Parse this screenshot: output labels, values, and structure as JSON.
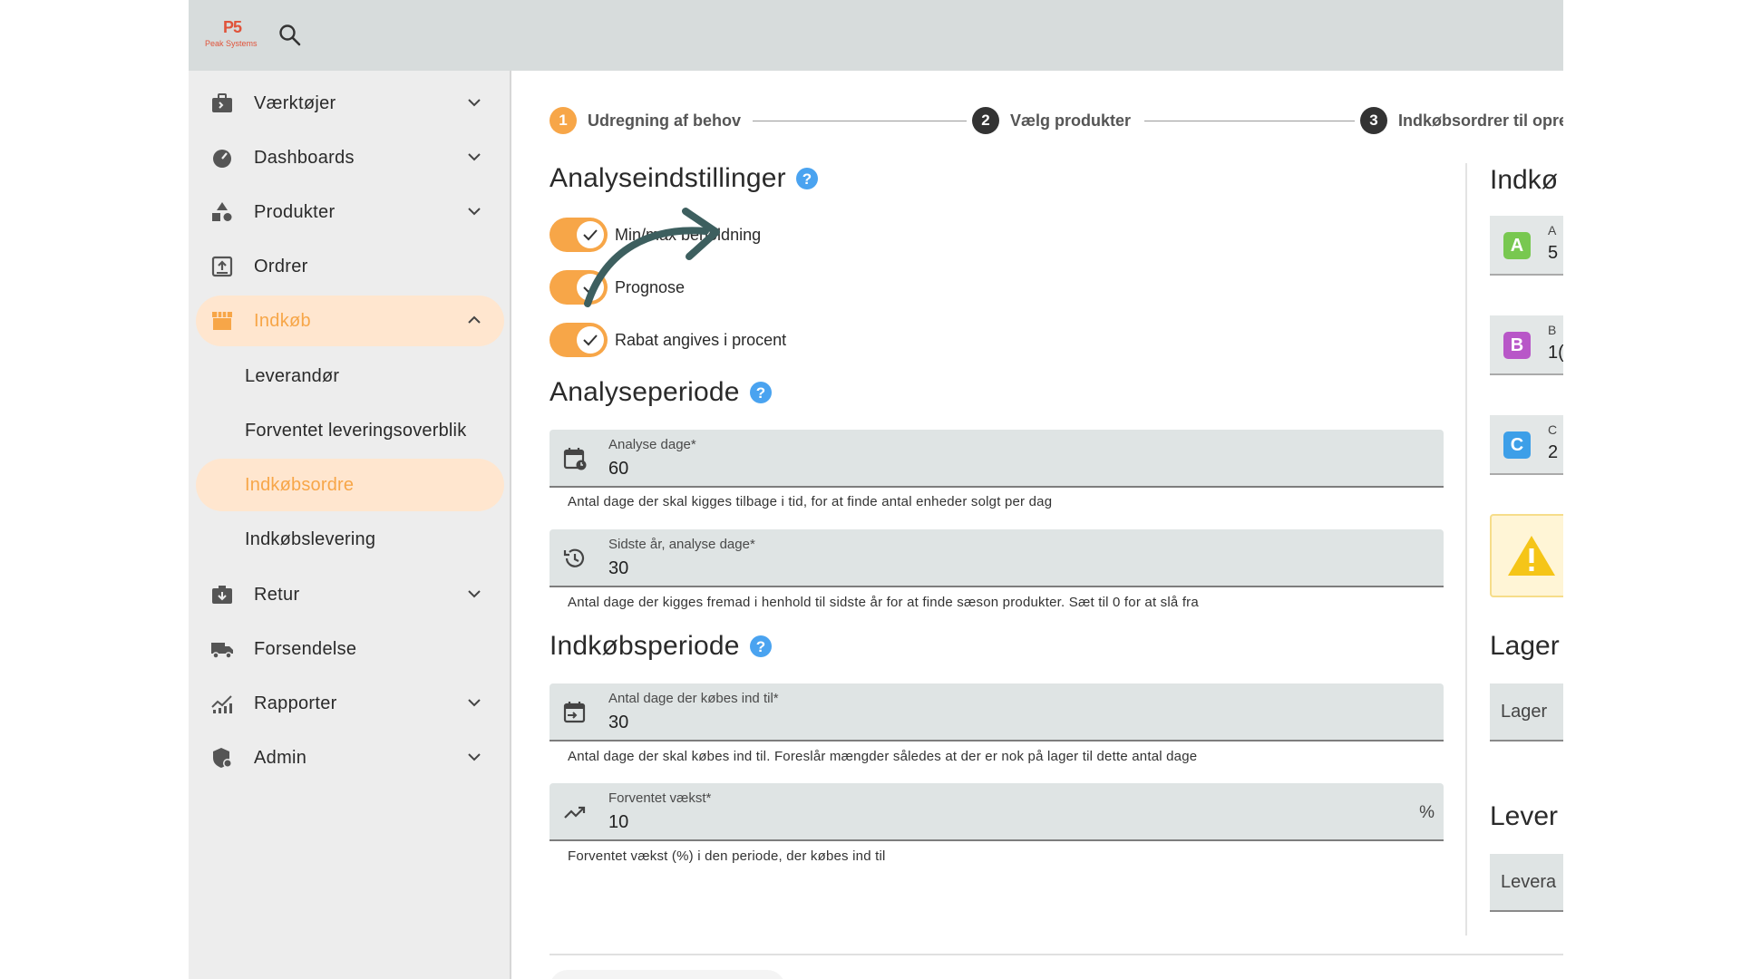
{
  "brand": {
    "mark": "P5",
    "name": "Peak Systems"
  },
  "sidebar": {
    "items": [
      {
        "label": "Værktøjer",
        "icon": "toolbox-icon",
        "expandable": true
      },
      {
        "label": "Dashboards",
        "icon": "gauge-icon",
        "expandable": true
      },
      {
        "label": "Produkter",
        "icon": "shapes-icon",
        "expandable": true
      },
      {
        "label": "Ordrer",
        "icon": "order-upload-icon",
        "expandable": false
      },
      {
        "label": "Indkøb",
        "icon": "store-icon",
        "expandable": true,
        "expanded": true,
        "active": true
      },
      {
        "label": "Retur",
        "icon": "return-box-icon",
        "expandable": true
      },
      {
        "label": "Forsendelse",
        "icon": "truck-icon",
        "expandable": false
      },
      {
        "label": "Rapporter",
        "icon": "chart-icon",
        "expandable": true
      },
      {
        "label": "Admin",
        "icon": "admin-shield-icon",
        "expandable": true
      }
    ],
    "subitems": [
      {
        "label": "Leverandør"
      },
      {
        "label": "Forventet leveringsoverblik"
      },
      {
        "label": "Indkøbsordre",
        "active": true
      },
      {
        "label": "Indkøbslevering"
      }
    ]
  },
  "stepper": [
    {
      "num": "1",
      "label": "Udregning af behov",
      "state": "active"
    },
    {
      "num": "2",
      "label": "Vælg produkter",
      "state": "pending"
    },
    {
      "num": "3",
      "label": "Indkøbsordrer til opre",
      "state": "pending"
    }
  ],
  "analysis_settings": {
    "title": "Analyseindstillinger",
    "toggles": [
      {
        "label": "Min/max beholdning",
        "checked": true
      },
      {
        "label": "Prognose",
        "checked": true
      },
      {
        "label": "Rabat angives i procent",
        "checked": true
      }
    ]
  },
  "analysis_period": {
    "title": "Analyseperiode",
    "fields": [
      {
        "label": "Analyse dage*",
        "value": "60",
        "hint": "Antal dage der skal kigges tilbage i tid, for at finde antal enheder solgt per dag"
      },
      {
        "label": "Sidste år, analyse dage*",
        "value": "30",
        "hint": "Antal dage der kigges fremad i henhold til sidste år for at finde sæson produkter. Sæt til 0 for at slå fra"
      }
    ]
  },
  "purchase_period": {
    "title": "Indkøbsperiode",
    "fields": [
      {
        "label": "Antal dage der købes ind til*",
        "value": "30",
        "hint": "Antal dage der skal købes ind til. Foreslår mængder således at der er nok på lager til dette antal dage"
      },
      {
        "label": "Forventet vækst*",
        "value": "10",
        "suffix": "%",
        "hint": "Forventet vækst (%) i den periode, der købes ind til"
      }
    ]
  },
  "right_panel": {
    "title_1": "Indkø",
    "categories": [
      {
        "badge": "A",
        "small": "A",
        "value": "5",
        "color": "#78c850"
      },
      {
        "badge": "B",
        "small": "B",
        "value": "1(",
        "color": "#b857c8"
      },
      {
        "badge": "C",
        "small": "C",
        "value": "2",
        "color": "#3d9fe8"
      }
    ],
    "title_2": "Lager",
    "field_2": "Lager",
    "title_3": "Lever",
    "field_3": "Levera"
  },
  "colors": {
    "accent": "#f7a648",
    "accent_bg": "#ffe6cf",
    "help": "#4aa3f0",
    "arrow": "#3d5f5f"
  }
}
